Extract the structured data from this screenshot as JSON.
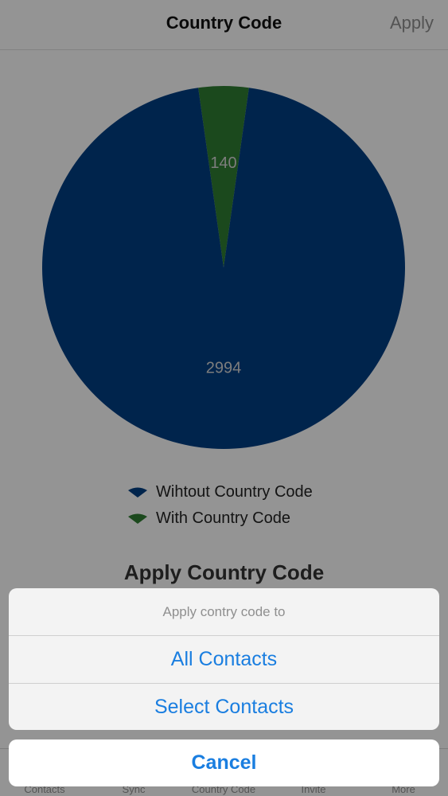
{
  "navbar": {
    "title": "Country Code",
    "apply_label": "Apply"
  },
  "chart_data": {
    "type": "pie",
    "title": "",
    "labels": [
      "Wihtout Country Code",
      "With Country Code"
    ],
    "values": [
      2994,
      140
    ],
    "data_labels": [
      "2994",
      "140"
    ],
    "colors": [
      "#003c7f",
      "#2e7a31"
    ],
    "legend_position": "bottom"
  },
  "legend": {
    "items": [
      {
        "label": "Wihtout Country Code",
        "color": "#003c7f"
      },
      {
        "label": "With Country Code",
        "color": "#2e7a31"
      }
    ]
  },
  "apply_heading": "Apply Country Code",
  "tabbar": {
    "items": [
      {
        "label": "Contacts",
        "icon": "contacts-icon"
      },
      {
        "label": "Sync",
        "icon": "sync-icon"
      },
      {
        "label": "Country Code",
        "icon": "globe-icon"
      },
      {
        "label": "Invite",
        "icon": "invite-icon"
      },
      {
        "label": "More",
        "icon": "more-icon"
      }
    ]
  },
  "action_sheet": {
    "title": "Apply contry code to",
    "options": [
      "All Contacts",
      "Select Contacts"
    ],
    "cancel_label": "Cancel"
  },
  "colors": {
    "accent": "#1a7ee0"
  }
}
